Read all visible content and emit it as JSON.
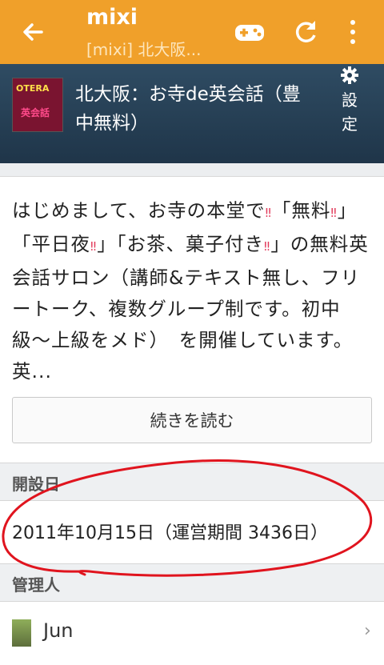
{
  "appbar": {
    "title": "mixi",
    "subtitle": "[mixi] 北大阪..."
  },
  "community": {
    "thumb_lines": [
      "OTERA",
      "英会話"
    ],
    "title": "北大阪：お寺de英会話（豊中無料）",
    "settings_label": "設定"
  },
  "description": {
    "parts": [
      "はじめまして、お寺の本堂で",
      "「無料",
      "」「平日夜",
      "」「お茶、菓子付き",
      "」の無料英会話サロン（講師&テキスト無し、フリートーク、複数グループ制です。初中級〜上級をメド）　を開催しています。英..."
    ],
    "emoji": "‼"
  },
  "more_button": "続きを読む",
  "founded": {
    "heading": "開設日",
    "value": "2011年10月15日（運営期間  3436日）"
  },
  "admin": {
    "heading": "管理人",
    "name": "Jun"
  },
  "colors": {
    "appbar": "#f0a02a",
    "header": "#263f55",
    "annotation": "#e0141e"
  }
}
